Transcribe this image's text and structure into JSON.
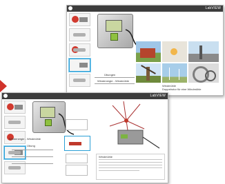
{
  "windows": [
    {
      "id": "back",
      "brand": "LabVIEW",
      "caption_left": "Übungen",
      "caption_mid": "Windenergie - Windmühle",
      "caption_right": "Windmühle",
      "caption_sub": "Doppelrotor für eine Windmühle"
    },
    {
      "id": "front",
      "brand": "LabVIEW",
      "caption_left": "Windenergie - Windmühle",
      "caption_mid": "Übung",
      "caption_right": "Windmühle"
    }
  ],
  "icons": {
    "arrow": "arrow-right-icon",
    "logo": "logo-icon"
  },
  "colors": {
    "accent": "#2a9fd6",
    "arrow": "#d1332b",
    "titlebar": "#3c3c3c"
  }
}
